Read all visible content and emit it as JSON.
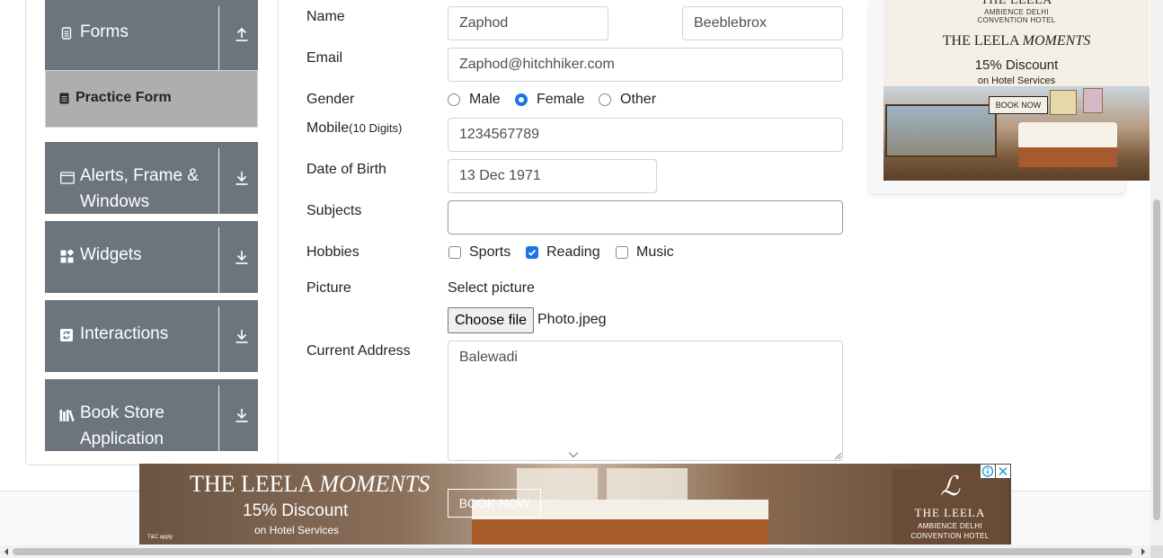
{
  "sidebar": {
    "groups": [
      {
        "title": "Forms",
        "icon": "document-icon",
        "toggle": "upload-icon"
      },
      {
        "title": "Alerts, Frame &",
        "title2": "Windows",
        "icon": "window-icon",
        "toggle": "download-icon"
      },
      {
        "title": "Widgets",
        "icon": "widgets-icon",
        "toggle": "download-icon"
      },
      {
        "title": "Interactions",
        "icon": "refresh-icon",
        "toggle": "download-icon"
      },
      {
        "title": "Book Store",
        "title2": "Application",
        "icon": "books-icon",
        "toggle": "download-icon"
      }
    ],
    "active_item": "Practice Form"
  },
  "form": {
    "name_label": "Name",
    "first_name": "Zaphod",
    "last_name": "Beeblebrox",
    "email_label": "Email",
    "email": "Zaphod@hitchhiker.com",
    "gender_label": "Gender",
    "gender_options": [
      "Male",
      "Female",
      "Other"
    ],
    "gender_selected": "Female",
    "mobile_label": "Mobile",
    "mobile_hint": "(10 Digits)",
    "mobile": "1234567789",
    "dob_label": "Date of Birth",
    "dob": "13 Dec 1971",
    "subjects_label": "Subjects",
    "subjects": "",
    "hobbies_label": "Hobbies",
    "hobbies": [
      "Sports",
      "Reading",
      "Music"
    ],
    "hobbies_checked": [
      "Reading"
    ],
    "picture_label": "Picture",
    "picture_prompt": "Select picture",
    "choose_file": "Choose file",
    "file_name": "Photo.jpeg",
    "address_label": "Current Address",
    "address": "Balewadi"
  },
  "ads": {
    "top": {
      "brand": "THE LEELA",
      "venue1": "AMBIENCE DELHI",
      "venue2": "CONVENTION HOTEL",
      "headline_a": "THE LEELA ",
      "headline_b": "MOMENTS",
      "offer": "15% Discount",
      "offer_sub": "on Hotel Services",
      "cta": "BOOK NOW"
    },
    "bottom": {
      "headline_a": "THE LEELA ",
      "headline_b": "MOMENTS",
      "offer": "15% Discount",
      "offer_sub": "on Hotel Services",
      "cta": "BOOK NOW",
      "fine_print": "T&C apply",
      "brand": "THE LEELA",
      "venue1": "AMBIENCE DELHI",
      "venue2": "CONVENTION HOTEL"
    }
  },
  "colors": {
    "sidebar_group": "#6c757d",
    "sidebar_active": "#aeaeae",
    "accent": "#1a73e8"
  }
}
